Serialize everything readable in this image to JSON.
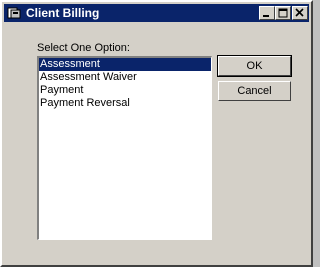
{
  "window": {
    "title": "Client Billing"
  },
  "dialog": {
    "prompt_label": "Select One Option:",
    "options": [
      {
        "label": "Assessment",
        "selected": true
      },
      {
        "label": "Assessment Waiver",
        "selected": false
      },
      {
        "label": "Payment",
        "selected": false
      },
      {
        "label": "Payment Reversal",
        "selected": false
      }
    ],
    "ok_label": "OK",
    "cancel_label": "Cancel"
  },
  "colors": {
    "titlebar": "#0a246a",
    "face": "#d4d0c8",
    "selection": "#0a246a"
  },
  "icons": [
    "app-icon",
    "minimize-icon",
    "maximize-icon",
    "close-icon"
  ]
}
